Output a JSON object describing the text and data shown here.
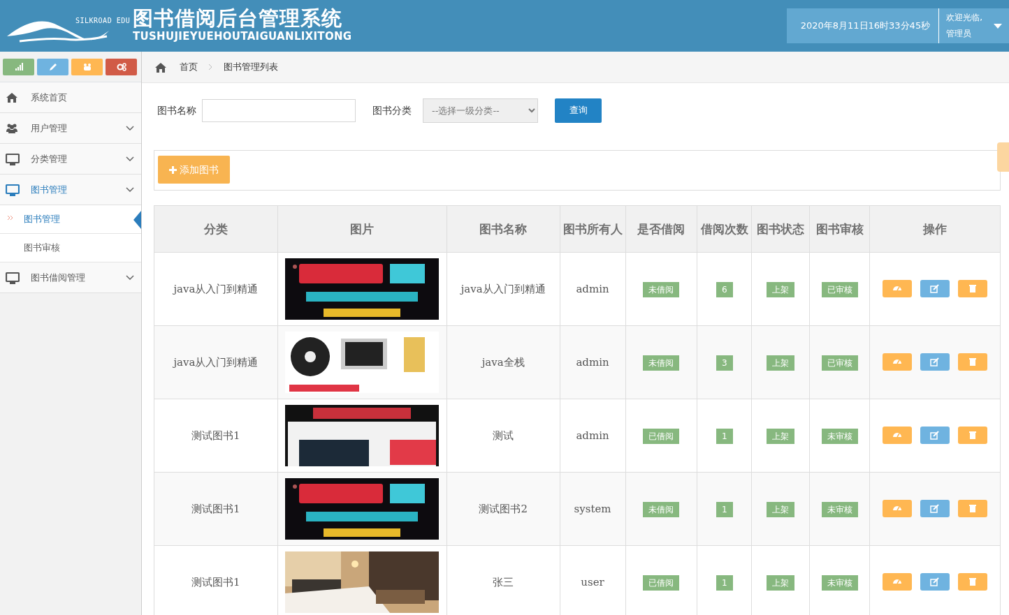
{
  "header": {
    "logo_text": "SILKROAD EDU",
    "title": "图书借阅后台管理系统",
    "subtitle": "TUSHUJIEYUEHOUTAIGUANLIXITONG",
    "datetime": "2020年8月11日16时33分45秒",
    "welcome": "欢迎光临,",
    "user": "管理员"
  },
  "shortcuts": [
    {
      "kind": "chart",
      "color": "#87b87f"
    },
    {
      "kind": "pencil",
      "color": "#6fb3e0"
    },
    {
      "kind": "users",
      "color": "#ffb752"
    },
    {
      "kind": "cogs",
      "color": "#d15b47"
    }
  ],
  "sidebar": {
    "items": [
      {
        "kind": "home",
        "label": "系统首页",
        "has_caret": false,
        "selected": false
      },
      {
        "kind": "users",
        "label": "用户管理",
        "has_caret": true,
        "selected": false
      },
      {
        "kind": "monitor",
        "label": "分类管理",
        "has_caret": true,
        "selected": false
      },
      {
        "kind": "monitor",
        "label": "图书管理",
        "has_caret": true,
        "selected": true,
        "children": [
          {
            "label": "图书管理",
            "selected": true
          },
          {
            "label": "图书审核",
            "selected": false
          }
        ]
      },
      {
        "kind": "monitor",
        "label": "图书借阅管理",
        "has_caret": true,
        "selected": false
      }
    ]
  },
  "breadcrumb": [
    "首页",
    "图书管理列表"
  ],
  "search": {
    "name_label": "图书名称",
    "category_label": "图书分类",
    "category_placeholder": "--选择一级分类--",
    "query_button": "查询"
  },
  "add_button": "添加图书",
  "table": {
    "columns": [
      "分类",
      "图片",
      "图书名称",
      "图书所有人",
      "是否借阅",
      "借阅次数",
      "图书状态",
      "图书审核",
      "操作"
    ],
    "rows": [
      {
        "category": "java从入门到精通",
        "name": "java从入门到精通",
        "owner": "admin",
        "borrowed": "未借阅",
        "count": "6",
        "status": "上架",
        "audit": "已审核"
      },
      {
        "category": "java从入门到精通",
        "name": "java全栈",
        "owner": "admin",
        "borrowed": "未借阅",
        "count": "3",
        "status": "上架",
        "audit": "已审核"
      },
      {
        "category": "测试图书1",
        "name": "测试",
        "owner": "admin",
        "borrowed": "已借阅",
        "count": "1",
        "status": "上架",
        "audit": "未审核"
      },
      {
        "category": "测试图书1",
        "name": "测试图书2",
        "owner": "system",
        "borrowed": "未借阅",
        "count": "1",
        "status": "上架",
        "audit": "未审核"
      },
      {
        "category": "测试图书1",
        "name": "张三",
        "owner": "user",
        "borrowed": "已借阅",
        "count": "1",
        "status": "上架",
        "audit": "未审核"
      }
    ]
  }
}
